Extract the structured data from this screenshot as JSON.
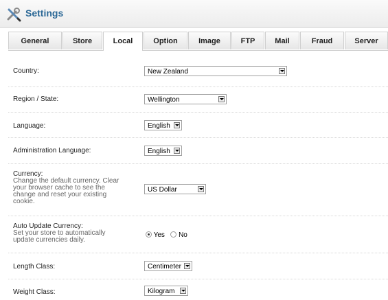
{
  "header": {
    "title": "Settings"
  },
  "tabs": [
    {
      "label": "General"
    },
    {
      "label": "Store"
    },
    {
      "label": "Local"
    },
    {
      "label": "Option"
    },
    {
      "label": "Image"
    },
    {
      "label": "FTP"
    },
    {
      "label": "Mail"
    },
    {
      "label": "Fraud"
    },
    {
      "label": "Server"
    }
  ],
  "active_tab": "Local",
  "form": {
    "country": {
      "label": "Country:",
      "value": "New Zealand"
    },
    "region": {
      "label": "Region / State:",
      "value": "Wellington"
    },
    "language": {
      "label": "Language:",
      "value": "English"
    },
    "admin_language": {
      "label": "Administration Language:",
      "value": "English"
    },
    "currency": {
      "label": "Currency:",
      "help": "Change the default currency. Clear your browser cache to see the change and reset your existing cookie.",
      "value": "US Dollar"
    },
    "auto_update": {
      "label": "Auto Update Currency:",
      "help": "Set your store to automatically update currencies daily.",
      "yes": "Yes",
      "no": "No",
      "selected": "Yes"
    },
    "length_class": {
      "label": "Length Class:",
      "value": "Centimeter"
    },
    "weight_class": {
      "label": "Weight Class:",
      "value": "Kilogram"
    }
  }
}
